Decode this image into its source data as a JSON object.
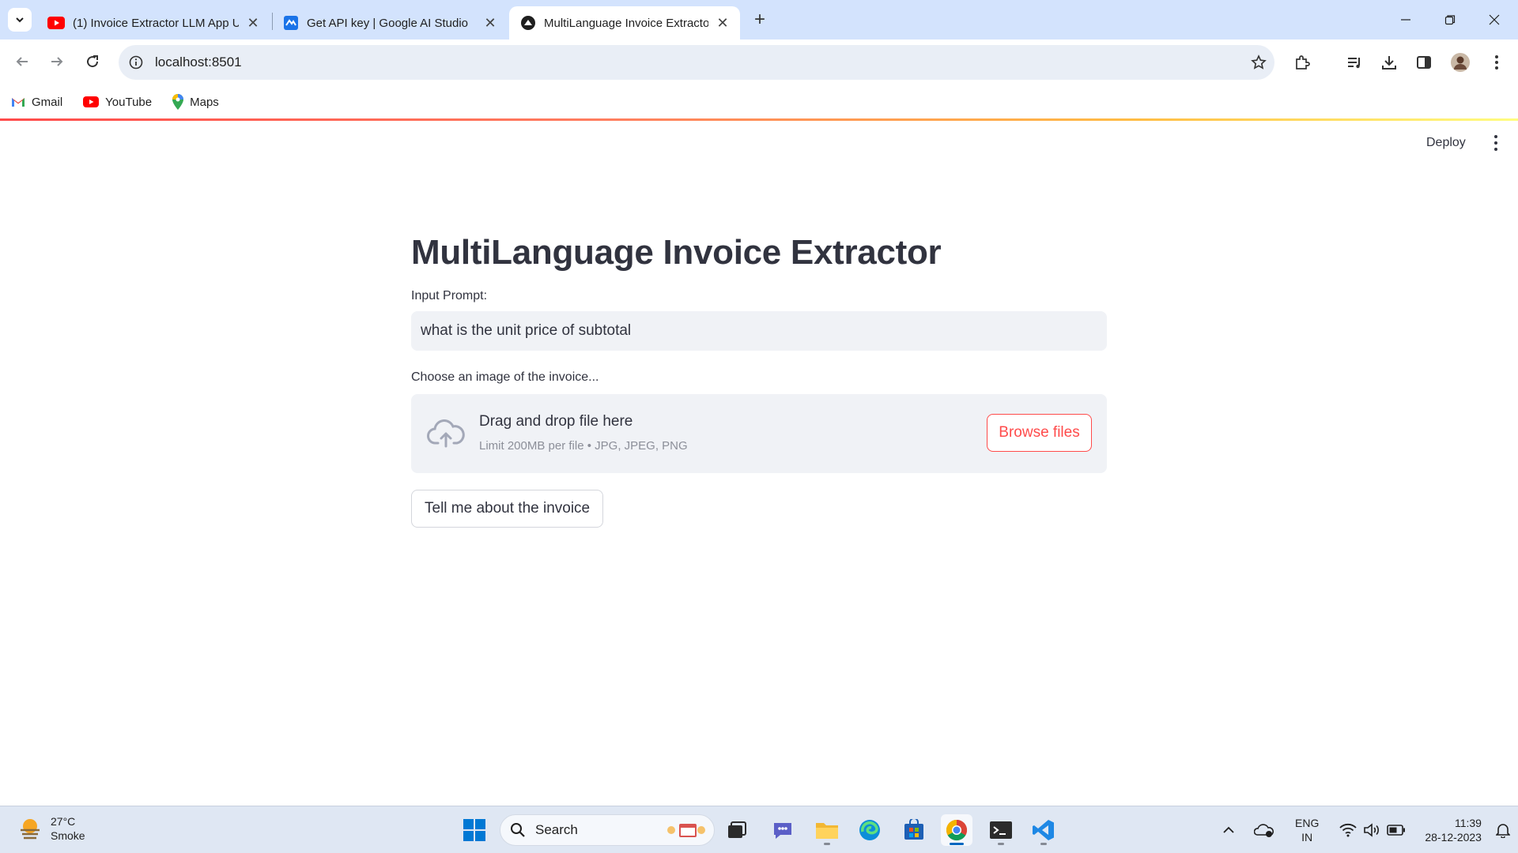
{
  "browser": {
    "tabs": [
      {
        "label": "(1) Invoice Extractor LLM App U",
        "icon": "youtube-icon",
        "active": false
      },
      {
        "label": "Get API key | Google AI Studio",
        "icon": "ai-studio-icon",
        "active": false
      },
      {
        "label": "MultiLanguage Invoice Extracto",
        "icon": "streamlit-icon",
        "active": true
      }
    ],
    "new_tab_label": "+",
    "url": "localhost:8501",
    "bookmarks": [
      {
        "label": "Gmail",
        "icon": "gmail-icon"
      },
      {
        "label": "YouTube",
        "icon": "youtube-icon"
      },
      {
        "label": "Maps",
        "icon": "maps-icon"
      }
    ]
  },
  "app": {
    "deploy_label": "Deploy",
    "title": "MultiLanguage Invoice Extractor",
    "input_label": "Input Prompt:",
    "input_value": "what is the unit price of subtotal",
    "uploader_label": "Choose an image of the invoice...",
    "uploader_drag_text": "Drag and drop file here",
    "uploader_limit_text": "Limit 200MB per file • JPG, JPEG, PNG",
    "browse_label": "Browse files",
    "submit_label": "Tell me about the invoice",
    "accent_color": "#ff4b4b"
  },
  "taskbar": {
    "weather": {
      "temp": "27°C",
      "condition": "Smoke"
    },
    "search_label": "Search",
    "apps": [
      "start-icon",
      "task-view-icon",
      "teams-chat-icon",
      "file-explorer-icon",
      "edge-icon",
      "store-icon",
      "chrome-icon",
      "terminal-icon",
      "vscode-icon"
    ],
    "language": {
      "line1": "ENG",
      "line2": "IN"
    },
    "time": "11:39",
    "date": "28-12-2023"
  }
}
